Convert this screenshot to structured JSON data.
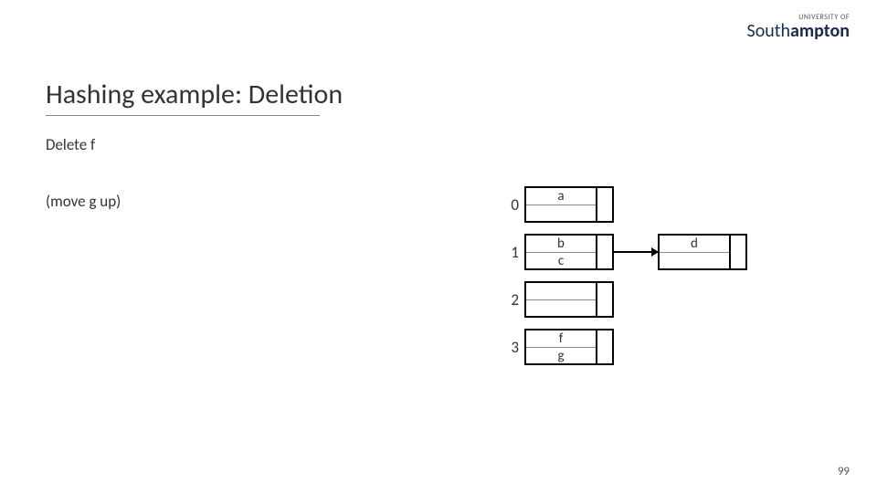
{
  "logo": {
    "top": "UNIVERSITY OF",
    "main_light": "South",
    "main_bold": "ampton"
  },
  "slide": {
    "title": "Hashing example: Deletion",
    "line1": "Delete f",
    "line2": "(move g up)",
    "page_number": "99"
  },
  "buckets": {
    "idx0": "0",
    "idx1": "1",
    "idx2": "2",
    "idx3": "3",
    "b0s0": "a",
    "b0s1": "",
    "b1s0": "b",
    "b1s1": "c",
    "ov1s0": "d",
    "ov1s1": "",
    "b2s0": "",
    "b2s1": "",
    "b3s0": "f",
    "b3s1": "g"
  }
}
